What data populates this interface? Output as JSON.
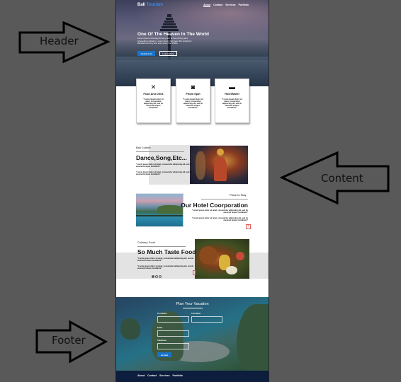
{
  "annotations": {
    "header_label": "Header",
    "content_label": "Content",
    "footer_label": "Footer"
  },
  "nav": {
    "logo_main": "Bali",
    "logo_accent": "Tourism",
    "accent_color": "#3d8ee8",
    "links": [
      "About",
      "Contact",
      "Services",
      "Portfolio"
    ]
  },
  "hero": {
    "title": "One Of The Heaven In The World",
    "text": "Lorem ipsum is simply dummy text of the printing and typesetting industry. Lorem Ipsum has been the industry's standard dummy text ever since the 1500s.",
    "primary_button": "Contact Us",
    "secondary_button": "Learn More"
  },
  "services": [
    {
      "icon": "utensils-icon",
      "glyph": "✕",
      "title": "Food And Drink",
      "desc": "\"Lorem ipsum dolor sit amet, consectetur adipiscing elit, sed do eiusmod tempor incididunt\""
    },
    {
      "icon": "camera-icon",
      "glyph": "◙",
      "title": "Photo Spot",
      "desc": "\"Lorem ipsum dolor sit amet, consectetur adipiscing elit, sed do eiusmod tempor incididunt\""
    },
    {
      "icon": "bed-icon",
      "glyph": "▬",
      "title": "Hotel/Motel",
      "desc": "\"Lorem ipsum dolor sit amet, consectetur adipiscing elit, sed do eiusmod tempor incididunt\""
    }
  ],
  "features": [
    {
      "kicker": "Bali Culture",
      "title": "Dance,Song,Etc...",
      "p1": "\"Lorem ipsum dolor sit amet, consectetur adipiscing elit, sed do eiusmod tempor incididunt\"",
      "p2": "\"Lorem ipsum dolor sit amet, consectetur adipiscing elit, sed do eiusmod tempor incididunt\""
    },
    {
      "kicker": "Place to Stay",
      "title": "Our Hotel Coorporation",
      "p1": "\"Lorem ipsum dolor sit amet, consectetur adipiscing elit, sed do eiusmod tempor incididunt\"",
      "p2": "\"Lorem ipsum dolor sit amet, consectetur adipiscing elit, sed do eiusmod tempor incididunt\""
    },
    {
      "kicker": "Culinary Food",
      "title": "So Much Taste Food",
      "p1": "\"Lorem ipsum dolor sit amet, consectetur adipiscing elit, sed do eiusmod tempor incididunt\"",
      "p2": "\"Lorem ipsum dolor sit amet, consectetur adipiscing elit, sed do eiusmod tempor incididunt\""
    }
  ],
  "carousel": {
    "slides": 3,
    "active": 1
  },
  "plan": {
    "title": "Plan Your Vacation",
    "first_name_label": "First Name",
    "last_name_label": "Last Name",
    "email_label": "Email",
    "phone_label": "Telephone",
    "submit": "Accept"
  },
  "footer": {
    "links": [
      "About",
      "Contact",
      "Services",
      "Portfolio"
    ]
  }
}
